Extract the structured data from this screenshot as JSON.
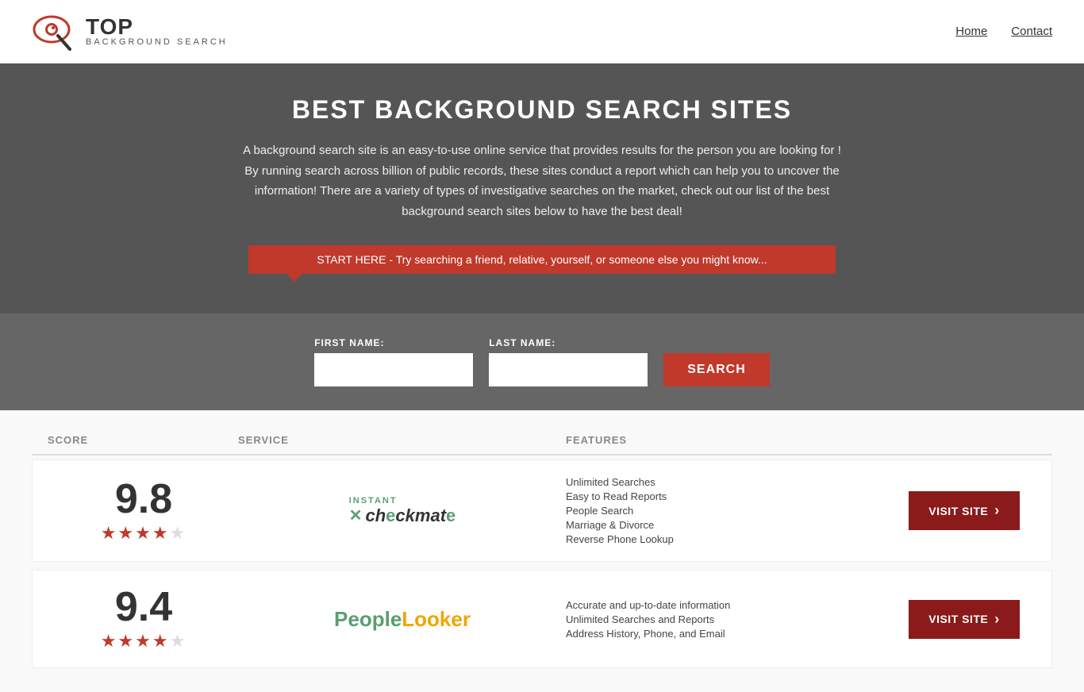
{
  "nav": {
    "logo_top": "TOP",
    "logo_bottom": "BACKGROUND SEARCH",
    "links": [
      {
        "label": "Home",
        "href": "#"
      },
      {
        "label": "Contact",
        "href": "#"
      }
    ]
  },
  "hero": {
    "title": "BEST BACKGROUND SEARCH SITES",
    "description": "A background search site is an easy-to-use online service that provides results  for the person you are looking for ! By  running  search across billion of public records, these sites conduct  a report which can help you to uncover the information! There are a variety of types of investigative searches on the market, check out our  list of the best background search sites below to have the best deal!",
    "banner_text": "START HERE - Try searching a friend, relative, yourself, or someone else you might know...",
    "first_name_label": "FIRST NAME:",
    "last_name_label": "LAST NAME:",
    "search_button": "SEARCH"
  },
  "table": {
    "headers": {
      "score": "SCORE",
      "service": "SERVICE",
      "features": "FEATURES",
      "action": ""
    },
    "rows": [
      {
        "score": "9.8",
        "stars": "★★★★★",
        "service_name": "Instant Checkmate",
        "features": [
          "Unlimited Searches",
          "Easy to Read Reports",
          "People Search",
          "Marriage & Divorce",
          "Reverse Phone Lookup"
        ],
        "visit_label": "VISIT SITE"
      },
      {
        "score": "9.4",
        "stars": "★★★★★",
        "service_name": "PeopleLooker",
        "features": [
          "Accurate and up-to-date information",
          "Unlimited Searches and Reports",
          "Address History, Phone, and Email"
        ],
        "visit_label": "VISIT SITE"
      }
    ]
  }
}
